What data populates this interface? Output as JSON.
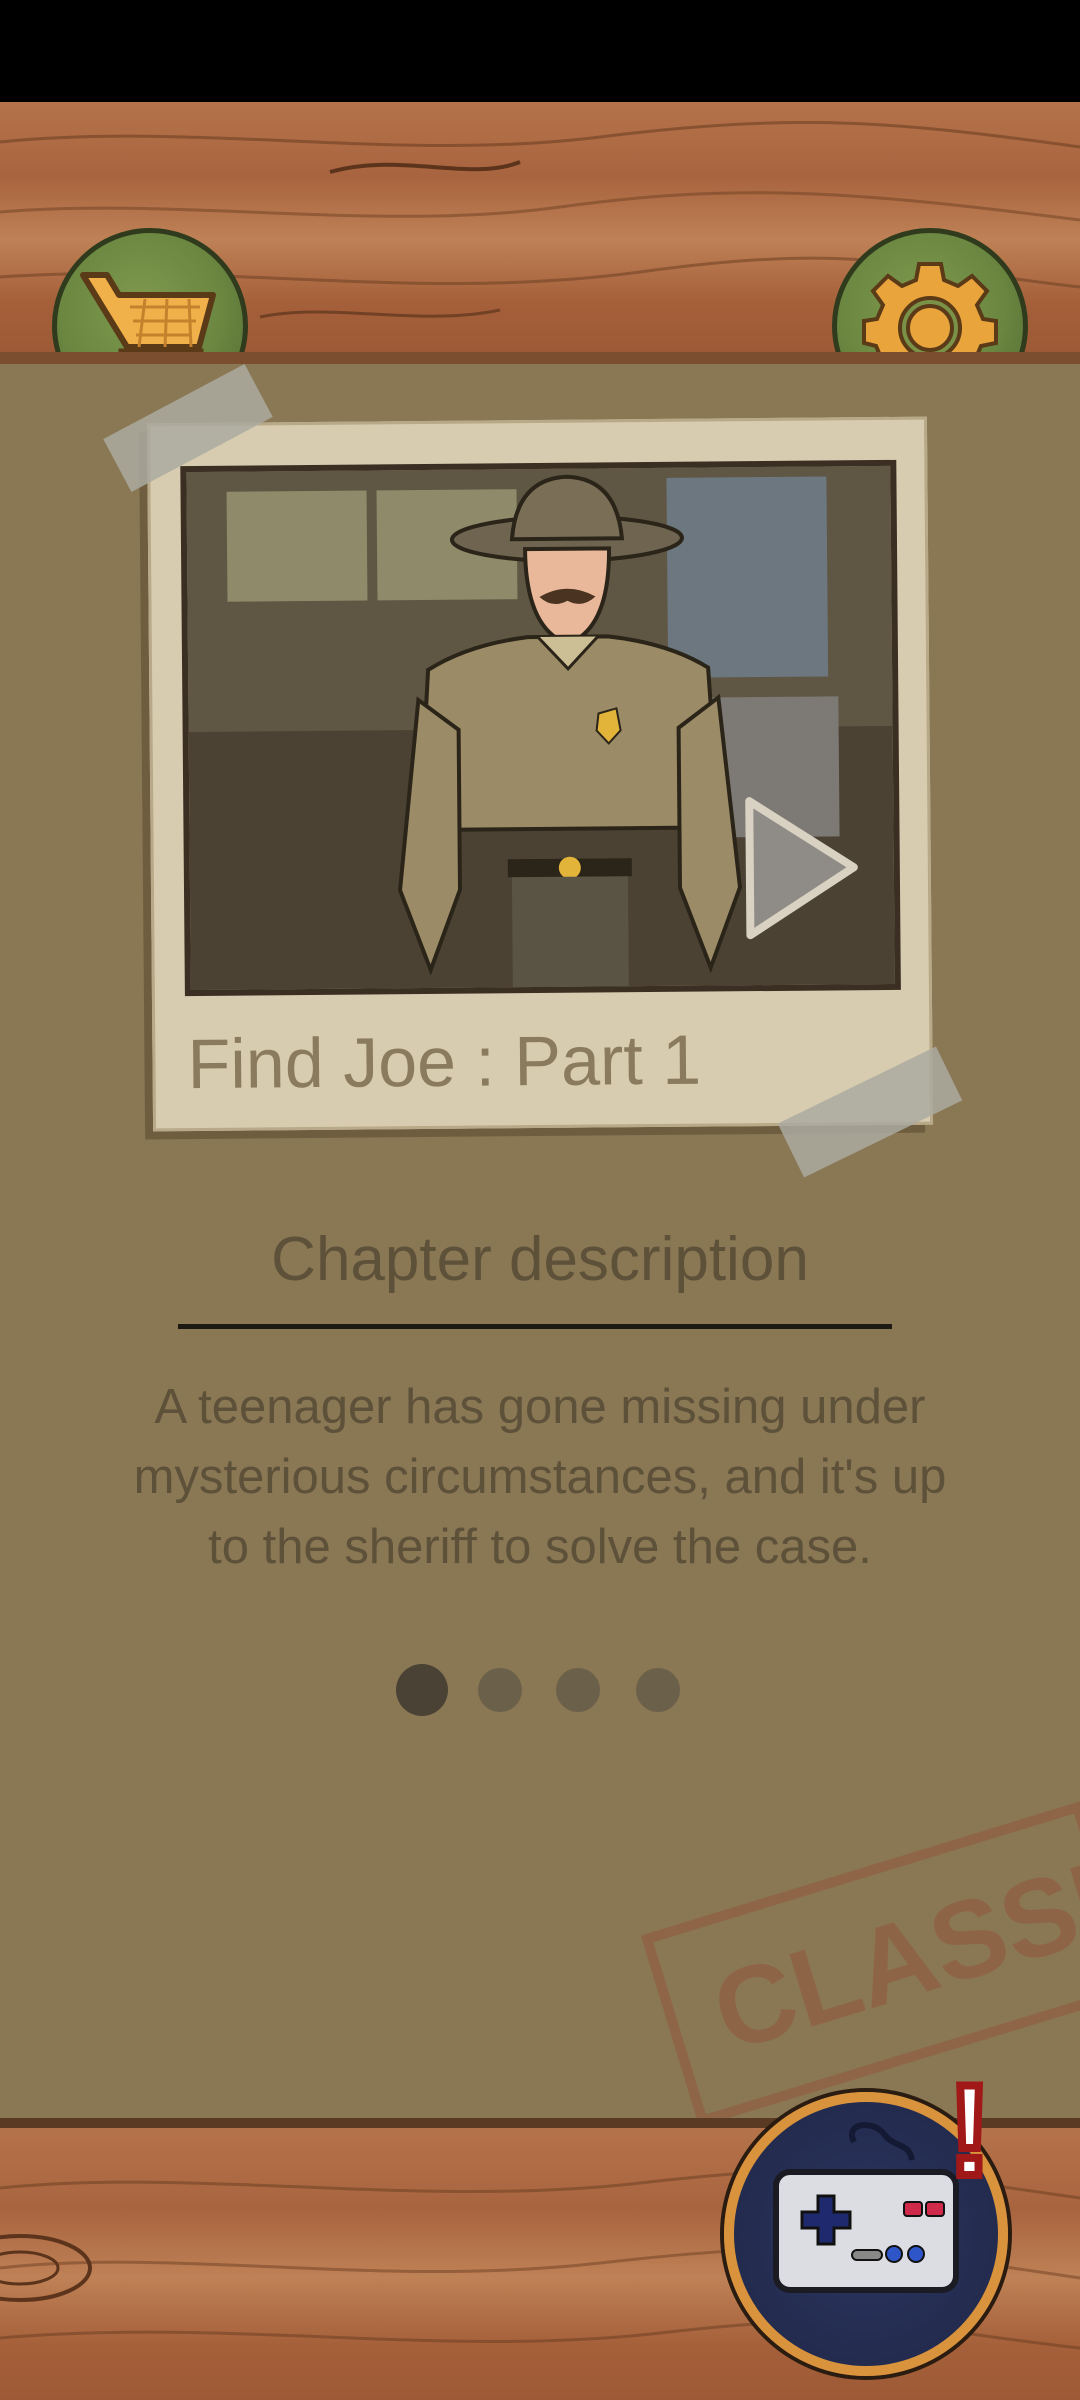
{
  "toolbar": {
    "shop_icon": "shopping-cart-icon",
    "settings_icon": "gear-icon"
  },
  "chapter": {
    "title": "Find Joe : Part 1",
    "play_icon": "play-icon",
    "description_heading": "Chapter description",
    "description_text": "A teenager has gone missing under mysterious circumstances, and it's up to the sheriff to solve the case."
  },
  "pager": {
    "count": 4,
    "active_index": 0
  },
  "background_stamp": "CLASSIFIED",
  "game_button": {
    "icon": "gamepad-icon",
    "alert_mark": "!"
  },
  "colors": {
    "paper": "#8a7754",
    "wood": "#b5734a",
    "button_green": "#6a8640",
    "accent_gold": "#e9a43b"
  }
}
